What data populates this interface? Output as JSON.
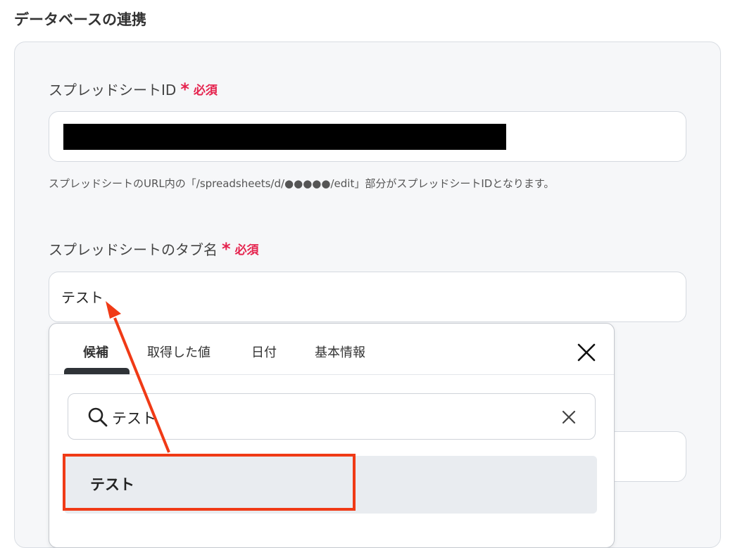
{
  "section": {
    "title": "データベースの連携"
  },
  "fields": {
    "spreadsheet_id": {
      "label": "スプレッドシートID",
      "required_text": "必須",
      "help": "スプレッドシートのURL内の「/spreadsheets/d/●●●●●/edit」部分がスプレッドシートIDとなります。"
    },
    "tab_name": {
      "label": "スプレッドシートのタブ名",
      "required_text": "必須",
      "value": "テスト"
    }
  },
  "required_mark": "*",
  "dropdown": {
    "tabs": [
      "候補",
      "取得した値",
      "日付",
      "基本情報"
    ],
    "active_tab": "候補",
    "search_value": "テスト",
    "options": [
      "テスト"
    ]
  },
  "colors": {
    "required": "#e5234e",
    "annotation": "#f03a16",
    "option_bg": "#e9ecf0",
    "card_bg": "#f6f7f9"
  },
  "icons": [
    "close-icon",
    "search-icon",
    "clear-icon",
    "arrow-annotation"
  ]
}
